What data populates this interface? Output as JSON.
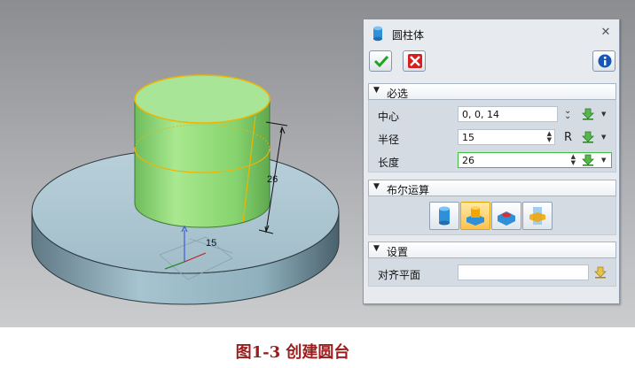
{
  "scene": {
    "dimension_height": "26",
    "dimension_radius": "15"
  },
  "dialog": {
    "title": "圆柱体",
    "close_glyph": "✕",
    "ok_icon": "check-icon",
    "cancel_icon": "cross-icon",
    "help_icon": "info-icon",
    "required_section": {
      "label": "必选",
      "rows": [
        {
          "label": "中心",
          "value": "0, 0, 14"
        },
        {
          "label": "半径",
          "value": "15",
          "suffix": "R"
        },
        {
          "label": "长度",
          "value": "26"
        }
      ]
    },
    "boolean_section": {
      "label": "布尔运算",
      "options": [
        "base",
        "add",
        "subtract",
        "intersect"
      ],
      "selected": "add"
    },
    "settings_section": {
      "label": "设置",
      "rows": [
        {
          "label": "对齐平面",
          "value": ""
        }
      ]
    }
  },
  "caption": "图1-3  创建圆台",
  "colors": {
    "cylinder": "#8fdc7a",
    "base": "#9fbfcc",
    "highlight_edge": "#f0b400",
    "caption": "#9b1c1c"
  }
}
